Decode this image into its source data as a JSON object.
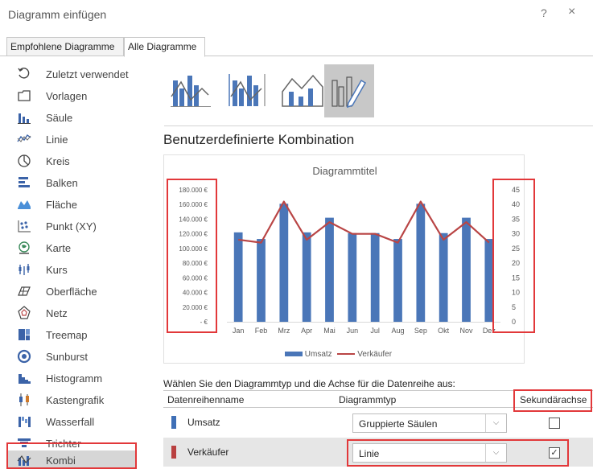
{
  "dialog": {
    "title": "Diagramm einfügen",
    "help_glyph": "?",
    "close_glyph": "×"
  },
  "tabs": [
    {
      "label": "Empfohlene Diagramme"
    },
    {
      "label": "Alle Diagramme"
    }
  ],
  "sidebar": {
    "items": [
      {
        "label": "Zuletzt verwendet",
        "icon": "recent-icon"
      },
      {
        "label": "Vorlagen",
        "icon": "folder-icon"
      },
      {
        "label": "Säule",
        "icon": "column-chart-icon"
      },
      {
        "label": "Linie",
        "icon": "line-chart-icon"
      },
      {
        "label": "Kreis",
        "icon": "pie-chart-icon"
      },
      {
        "label": "Balken",
        "icon": "bar-chart-icon"
      },
      {
        "label": "Fläche",
        "icon": "area-chart-icon"
      },
      {
        "label": "Punkt (XY)",
        "icon": "scatter-chart-icon"
      },
      {
        "label": "Karte",
        "icon": "map-chart-icon"
      },
      {
        "label": "Kurs",
        "icon": "stock-chart-icon"
      },
      {
        "label": "Oberfläche",
        "icon": "surface-chart-icon"
      },
      {
        "label": "Netz",
        "icon": "radar-chart-icon"
      },
      {
        "label": "Treemap",
        "icon": "treemap-icon"
      },
      {
        "label": "Sunburst",
        "icon": "sunburst-icon"
      },
      {
        "label": "Histogramm",
        "icon": "histogram-icon"
      },
      {
        "label": "Kastengrafik",
        "icon": "box-whisker-icon"
      },
      {
        "label": "Wasserfall",
        "icon": "waterfall-icon"
      },
      {
        "label": "Trichter",
        "icon": "funnel-icon"
      },
      {
        "label": "Kombi",
        "icon": "combo-chart-icon"
      }
    ],
    "selected": "Kombi"
  },
  "combo_types": [
    "clustered-column-line-icon",
    "clustered-column-line-secondary-icon",
    "stacked-area-column-icon",
    "custom-combination-icon"
  ],
  "section_heading": "Benutzerdefinierte Kombination",
  "instruction": "Wählen Sie den Diagrammtyp und die Achse für die Datenreihe aus:",
  "series_table": {
    "headers": {
      "name": "Datenreihenname",
      "type": "Diagrammtyp",
      "secondary": "Sekundärachse"
    },
    "rows": [
      {
        "name": "Umsatz",
        "color": "#3f6fb6",
        "type": "Gruppierte Säulen",
        "secondary": false
      },
      {
        "name": "Verkäufer",
        "color": "#b94040",
        "type": "Linie",
        "secondary": true
      }
    ],
    "dropdown_glyph": "⌵",
    "check_glyph": "✓"
  },
  "colors": {
    "column": "#4a76b8",
    "line": "#b94545",
    "highlight": "#e2383a"
  },
  "chart_data": {
    "type": "bar",
    "title": "Diagrammtitel",
    "categories": [
      "Jan",
      "Feb",
      "Mrz",
      "Apr",
      "Mai",
      "Jun",
      "Jul",
      "Aug",
      "Sep",
      "Okt",
      "Nov",
      "Dez"
    ],
    "series": [
      {
        "name": "Umsatz",
        "type": "bar",
        "axis": "primary",
        "values": [
          122000,
          113000,
          161000,
          122000,
          142000,
          121000,
          121000,
          113000,
          161000,
          121000,
          142000,
          113000
        ]
      },
      {
        "name": "Verkäufer",
        "type": "line",
        "axis": "secondary",
        "values": [
          28,
          27,
          41,
          28,
          34,
          30,
          30,
          27,
          41,
          28,
          34,
          27
        ]
      }
    ],
    "y_primary": {
      "ylim": [
        0,
        180000
      ],
      "ticks": [
        "180.000 €",
        "160.000 €",
        "140.000 €",
        "120.000 €",
        "100.000 €",
        "80.000 €",
        "60.000 €",
        "40.000 €",
        "20.000 €",
        "- €"
      ]
    },
    "y_secondary": {
      "ylim": [
        0,
        45
      ],
      "ticks": [
        "45",
        "40",
        "35",
        "30",
        "25",
        "20",
        "15",
        "10",
        "5",
        "0"
      ]
    },
    "legend_position": "bottom",
    "grid": false
  }
}
